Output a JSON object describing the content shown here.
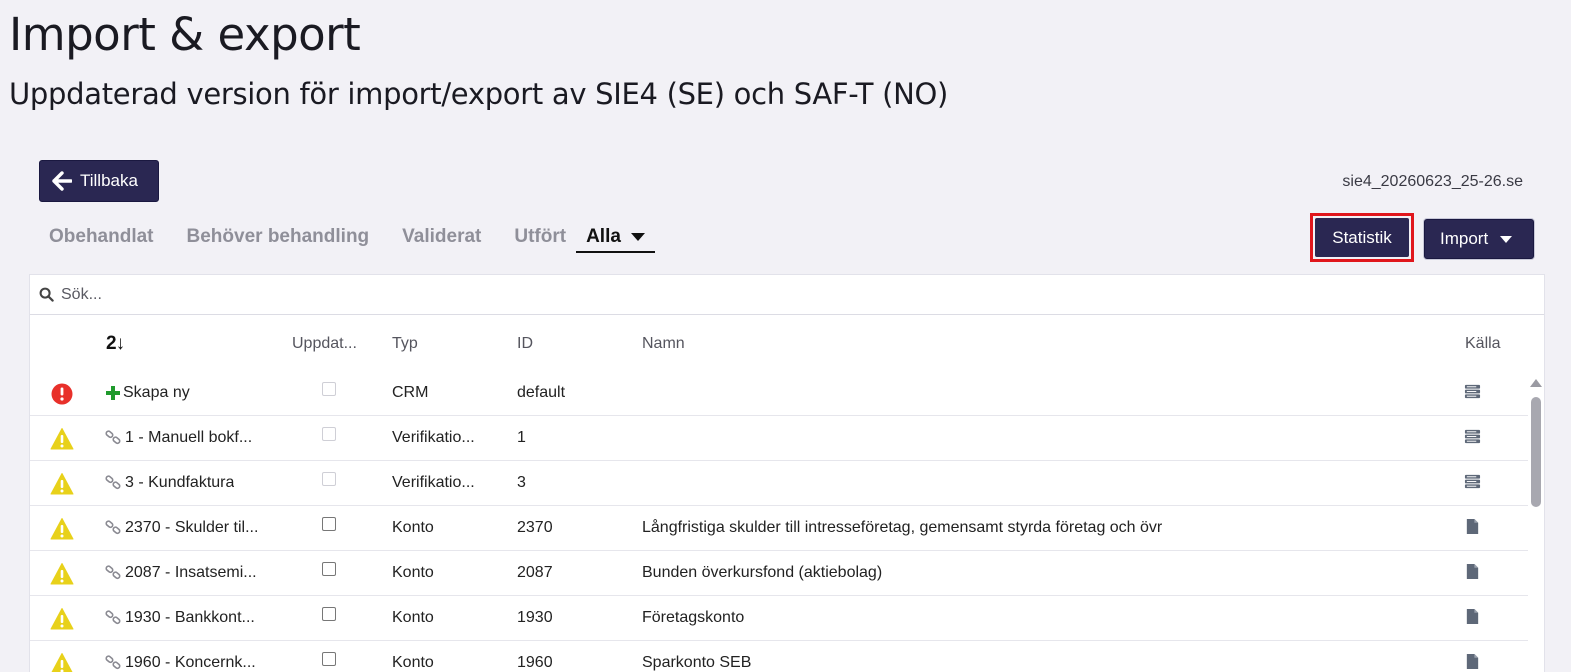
{
  "page": {
    "title": "Import & export",
    "subtitle": "Uppdaterad version för import/export av SIE4 (SE) och SAF-T (NO)"
  },
  "toolbar": {
    "back_label": "Tillbaka",
    "filename": "sie4_20260623_25-26.se",
    "statistics_label": "Statistik",
    "import_label": "Import"
  },
  "tabs": [
    {
      "label": "Obehandlat",
      "active": false
    },
    {
      "label": "Behöver behandling",
      "active": false
    },
    {
      "label": "Validerat",
      "active": false
    },
    {
      "label": "Utfört",
      "active": false
    },
    {
      "label": "Alla",
      "active": true
    }
  ],
  "search": {
    "placeholder": "Sök..."
  },
  "table": {
    "sort_icon_label": "2↓",
    "columns": [
      "Uppdat...",
      "Typ",
      "ID",
      "Namn",
      "Källa"
    ],
    "rows": [
      {
        "status": "error",
        "name_icon": "plus-icon",
        "name": "Skapa ny",
        "checkbox": "disabled",
        "type": "CRM",
        "id": "default",
        "desc": "",
        "source": "server-icon"
      },
      {
        "status": "warning",
        "name_icon": "link-icon",
        "name": "1 - Manuell bokf...",
        "checkbox": "disabled",
        "type": "Verifikatio...",
        "id": "1",
        "desc": "",
        "source": "server-icon"
      },
      {
        "status": "warning",
        "name_icon": "link-icon",
        "name": "3 - Kundfaktura",
        "checkbox": "disabled",
        "type": "Verifikatio...",
        "id": "3",
        "desc": "",
        "source": "server-icon"
      },
      {
        "status": "warning",
        "name_icon": "link-icon",
        "name": "2370 - Skulder til...",
        "checkbox": "enabled",
        "type": "Konto",
        "id": "2370",
        "desc": "Långfristiga skulder till intresseföretag, gemensamt styrda företag och övr",
        "source": "file-icon"
      },
      {
        "status": "warning",
        "name_icon": "link-icon",
        "name": "2087 - Insatsemi...",
        "checkbox": "enabled",
        "type": "Konto",
        "id": "2087",
        "desc": "Bunden överkursfond (aktiebolag)",
        "source": "file-icon"
      },
      {
        "status": "warning",
        "name_icon": "link-icon",
        "name": "1930 - Bankkont...",
        "checkbox": "enabled",
        "type": "Konto",
        "id": "1930",
        "desc": "Företagskonto",
        "source": "file-icon"
      },
      {
        "status": "warning",
        "name_icon": "link-icon",
        "name": "1960 - Koncernk...",
        "checkbox": "enabled",
        "type": "Konto",
        "id": "1960",
        "desc": "Sparkonto SEB",
        "source": "file-icon"
      }
    ]
  },
  "colors": {
    "primary": "#2a2752",
    "highlight": "#e0161c",
    "error": "#e8302a",
    "warning": "#e8d11a",
    "plus": "#1f9a2c"
  }
}
